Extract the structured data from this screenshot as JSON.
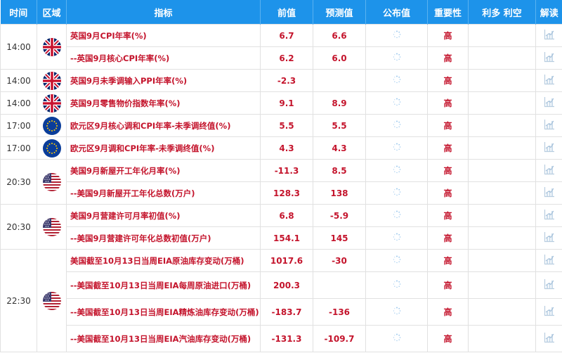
{
  "headers": {
    "time": "时间",
    "region": "区域",
    "indicator": "指标",
    "previous": "前值",
    "forecast": "预测值",
    "actual": "公布值",
    "importance": "重要性",
    "bull_bear": "利多 利空",
    "interpret": "解读"
  },
  "groups": [
    {
      "time": "14:00",
      "flag": "uk-flag-icon",
      "rows": [
        {
          "indicator": "英国9月CPI年率(%)",
          "previous": "6.7",
          "forecast": "6.6",
          "importance": "高"
        },
        {
          "indicator": "--英国9月核心CPI年率(%)",
          "previous": "6.2",
          "forecast": "6.0",
          "importance": "高"
        }
      ]
    },
    {
      "time": "14:00",
      "flag": "uk-flag-icon",
      "rows": [
        {
          "indicator": "英国9月未季调输入PPI年率(%)",
          "previous": "-2.3",
          "forecast": "",
          "importance": "高"
        }
      ]
    },
    {
      "time": "14:00",
      "flag": "uk-flag-icon",
      "rows": [
        {
          "indicator": "英国9月零售物价指数年率(%)",
          "previous": "9.1",
          "forecast": "8.9",
          "importance": "高"
        }
      ]
    },
    {
      "time": "17:00",
      "flag": "eu-flag-icon",
      "rows": [
        {
          "indicator": "欧元区9月核心调和CPI年率-未季调终值(%)",
          "previous": "5.5",
          "forecast": "5.5",
          "importance": "高"
        }
      ]
    },
    {
      "time": "17:00",
      "flag": "eu-flag-icon",
      "rows": [
        {
          "indicator": "欧元区9月调和CPI年率-未季调终值(%)",
          "previous": "4.3",
          "forecast": "4.3",
          "importance": "高"
        }
      ]
    },
    {
      "time": "20:30",
      "flag": "us-flag-icon",
      "rows": [
        {
          "indicator": "美国9月新屋开工年化月率(%)",
          "previous": "-11.3",
          "forecast": "8.5",
          "importance": "高"
        },
        {
          "indicator": "--美国9月新屋开工年化总数(万户)",
          "previous": "128.3",
          "forecast": "138",
          "importance": "高"
        }
      ]
    },
    {
      "time": "20:30",
      "flag": "us-flag-icon",
      "rows": [
        {
          "indicator": "美国9月营建许可月率初值(%)",
          "previous": "6.8",
          "forecast": "-5.9",
          "importance": "高"
        },
        {
          "indicator": "--美国9月营建许可年化总数初值(万户)",
          "previous": "154.1",
          "forecast": "145",
          "importance": "高"
        }
      ]
    },
    {
      "time": "22:30",
      "flag": "us-flag-icon",
      "rows": [
        {
          "indicator": "美国截至10月13日当周EIA原油库存变动(万桶)",
          "previous": "1017.6",
          "forecast": "-30",
          "importance": "高"
        },
        {
          "indicator": "--美国截至10月13日当周EIA每周原油进口(万桶)",
          "previous": "200.3",
          "forecast": "",
          "importance": "高"
        },
        {
          "indicator": "--美国截至10月13日当周EIA精炼油库存变动(万桶)",
          "previous": "-183.7",
          "forecast": "-136",
          "importance": "高"
        },
        {
          "indicator": "--美国截至10月13日当周EIA汽油库存变动(万桶)",
          "previous": "-131.3",
          "forecast": "-109.7",
          "importance": "高"
        }
      ]
    }
  ],
  "colors": {
    "header_bg": "#1d93ea",
    "value_red": "#c4142c",
    "border": "#e1e1e1"
  }
}
